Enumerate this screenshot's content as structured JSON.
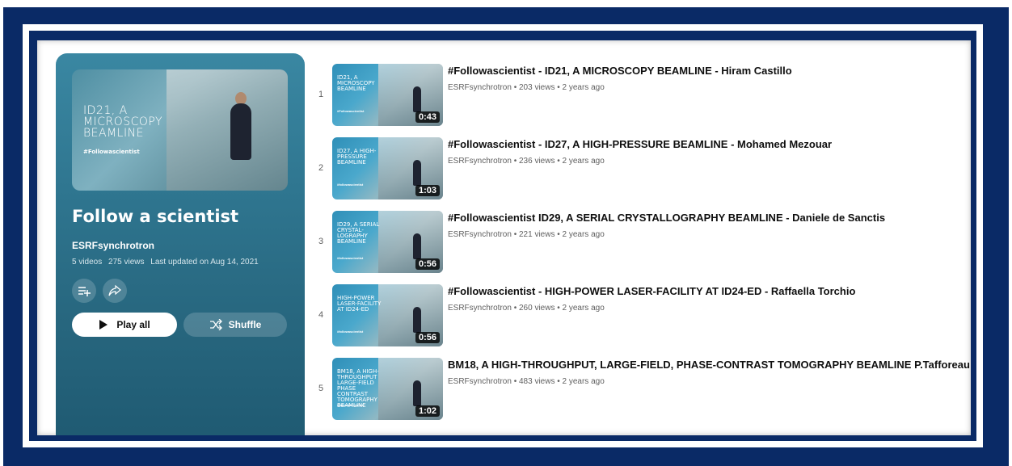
{
  "playlist": {
    "hero_text": "ID21, A MICROSCOPY BEAMLINE",
    "hero_tag": "#Followascientist",
    "title": "Follow a scientist",
    "owner": "ESRFsynchrotron",
    "video_count": "5 videos",
    "views": "275 views",
    "updated": "Last updated on Aug 14, 2021",
    "play_all_label": "Play all",
    "shuffle_label": "Shuffle",
    "icons": [
      "add-to-queue-icon",
      "share-icon",
      "play-icon",
      "shuffle-icon"
    ]
  },
  "videos": [
    {
      "index": "1",
      "title": "#Followascientist - ID21, A MICROSCOPY BEAMLINE - Hiram Castillo",
      "channel": "ESRFsynchrotron",
      "views": "203 views",
      "age": "2 years ago",
      "duration": "0:43",
      "thumb_text": "ID21, A MICROSCOPY BEAMLINE",
      "thumb_tag": "#Followascientist"
    },
    {
      "index": "2",
      "title": "#Followascientist - ID27, A HIGH-PRESSURE BEAMLINE - Mohamed Mezouar",
      "channel": "ESRFsynchrotron",
      "views": "236 views",
      "age": "2 years ago",
      "duration": "1:03",
      "thumb_text": "ID27, A HIGH-PRESSURE BEAMLINE",
      "thumb_tag": "#followascientist"
    },
    {
      "index": "3",
      "title": "#Followascientist ID29, A SERIAL CRYSTALLOGRAPHY BEAMLINE - Daniele de Sanctis",
      "channel": "ESRFsynchrotron",
      "views": "221 views",
      "age": "2 years ago",
      "duration": "0:56",
      "thumb_text": "ID29, A SERIAL CRYSTAL-LOGRAPHY BEAMLINE",
      "thumb_tag": "#followascientist"
    },
    {
      "index": "4",
      "title": "#Followascientist - HIGH-POWER LASER-FACILITY AT ID24-ED - Raffaella Torchio",
      "channel": "ESRFsynchrotron",
      "views": "260 views",
      "age": "2 years ago",
      "duration": "0:56",
      "thumb_text": "HIGH-POWER LASER-FACILITY AT ID24-ED",
      "thumb_tag": "#followascientist"
    },
    {
      "index": "5",
      "title": "BM18, A HIGH-THROUGHPUT, LARGE-FIELD, PHASE-CONTRAST TOMOGRAPHY BEAMLINE P.Tafforeau",
      "channel": "ESRFsynchrotron",
      "views": "483 views",
      "age": "2 years ago",
      "duration": "1:02",
      "thumb_text": "BM18, A HIGH-THROUGHPUT LARGE-FIELD PHASE CONTRAST TOMOGRAPHY BEAMLINE",
      "thumb_tag": "#followascientist"
    }
  ],
  "colors": {
    "frame": "#0a2a66",
    "panel": "#2f7690",
    "thumb": "#2f8fb8"
  }
}
